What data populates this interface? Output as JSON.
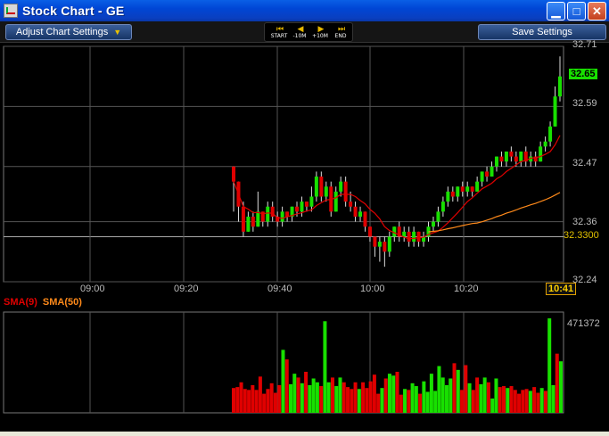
{
  "window": {
    "title": "Stock Chart - GE"
  },
  "toolbar": {
    "adjust_label": "Adjust Chart Settings",
    "save_label": "Save Settings",
    "playback": [
      {
        "icon": "skip-back-icon",
        "glyph": "⏮",
        "label": "START"
      },
      {
        "icon": "step-back-icon",
        "glyph": "◀",
        "label": "-10M"
      },
      {
        "icon": "step-forward-icon",
        "glyph": "▶",
        "label": "+10M"
      },
      {
        "icon": "skip-forward-icon",
        "glyph": "⏭",
        "label": "END"
      }
    ]
  },
  "colors": {
    "up": "#18e000",
    "down": "#e00000",
    "sma9": "#e00000",
    "sma50": "#ff8a1a",
    "grid": "#555555",
    "ref": "#e0c000"
  },
  "chart_data": {
    "type": "candlestick",
    "ticker": "GE",
    "time_ticks": [
      "09:00",
      "09:20",
      "09:40",
      "10:00",
      "10:20"
    ],
    "current_time": "10:41",
    "price_ticks": [
      "32.71",
      "32.59",
      "32.47",
      "32.36",
      "32.24"
    ],
    "current_price": "32.65",
    "reference_price": "32.3300",
    "ylim": [
      32.24,
      32.71
    ],
    "legend": [
      {
        "name": "SMA(9)",
        "color": "#e00000"
      },
      {
        "name": "SMA(50)",
        "color": "#ff8a1a"
      }
    ],
    "volume_max_label": "471372",
    "candles": [
      [
        32.47,
        32.44,
        32.38,
        32.47
      ],
      [
        32.44,
        32.39,
        32.36,
        32.44
      ],
      [
        32.39,
        32.34,
        32.33,
        32.4
      ],
      [
        32.34,
        32.37,
        32.34,
        32.38
      ],
      [
        32.37,
        32.35,
        32.34,
        32.38
      ],
      [
        32.35,
        32.38,
        32.35,
        32.42
      ],
      [
        32.38,
        32.36,
        32.35,
        32.38
      ],
      [
        32.36,
        32.39,
        32.35,
        32.4
      ],
      [
        32.39,
        32.37,
        32.36,
        32.4
      ],
      [
        32.37,
        32.36,
        32.35,
        32.38
      ],
      [
        32.36,
        32.38,
        32.35,
        32.39
      ],
      [
        32.38,
        32.37,
        32.36,
        32.38
      ],
      [
        32.37,
        32.39,
        32.36,
        32.39
      ],
      [
        32.39,
        32.38,
        32.37,
        32.4
      ],
      [
        32.38,
        32.4,
        32.37,
        32.41
      ],
      [
        32.4,
        32.39,
        32.38,
        32.4
      ],
      [
        32.39,
        32.41,
        32.38,
        32.43
      ],
      [
        32.41,
        32.45,
        32.4,
        32.46
      ],
      [
        32.45,
        32.41,
        32.4,
        32.46
      ],
      [
        32.41,
        32.43,
        32.4,
        32.44
      ],
      [
        32.43,
        32.38,
        32.37,
        32.44
      ],
      [
        32.38,
        32.42,
        32.38,
        32.43
      ],
      [
        32.42,
        32.44,
        32.41,
        32.45
      ],
      [
        32.44,
        32.4,
        32.39,
        32.45
      ],
      [
        32.4,
        32.39,
        32.38,
        32.42
      ],
      [
        32.39,
        32.37,
        32.36,
        32.4
      ],
      [
        32.37,
        32.38,
        32.36,
        32.39
      ],
      [
        32.38,
        32.35,
        32.34,
        32.38
      ],
      [
        32.35,
        32.33,
        32.32,
        32.35
      ],
      [
        32.33,
        32.31,
        32.29,
        32.33
      ],
      [
        32.31,
        32.32,
        32.28,
        32.33
      ],
      [
        32.32,
        32.3,
        32.27,
        32.33
      ],
      [
        32.3,
        32.33,
        32.29,
        32.34
      ],
      [
        32.33,
        32.35,
        32.32,
        32.35
      ],
      [
        32.35,
        32.33,
        32.32,
        32.36
      ],
      [
        32.33,
        32.34,
        32.32,
        32.35
      ],
      [
        32.34,
        32.32,
        32.31,
        32.35
      ],
      [
        32.32,
        32.34,
        32.31,
        32.35
      ],
      [
        32.34,
        32.32,
        32.31,
        32.34
      ],
      [
        32.32,
        32.33,
        32.31,
        32.34
      ],
      [
        32.33,
        32.35,
        32.32,
        32.36
      ],
      [
        32.35,
        32.36,
        32.34,
        32.37
      ],
      [
        32.36,
        32.38,
        32.35,
        32.39
      ],
      [
        32.38,
        32.4,
        32.37,
        32.41
      ],
      [
        32.4,
        32.42,
        32.39,
        32.43
      ],
      [
        32.42,
        32.41,
        32.4,
        32.43
      ],
      [
        32.41,
        32.43,
        32.4,
        32.43
      ],
      [
        32.43,
        32.42,
        32.41,
        32.44
      ],
      [
        32.42,
        32.43,
        32.41,
        32.44
      ],
      [
        32.43,
        32.42,
        32.41,
        32.43
      ],
      [
        32.42,
        32.44,
        32.42,
        32.45
      ],
      [
        32.44,
        32.46,
        32.43,
        32.46
      ],
      [
        32.46,
        32.45,
        32.44,
        32.47
      ],
      [
        32.45,
        32.47,
        32.45,
        32.48
      ],
      [
        32.47,
        32.49,
        32.46,
        32.49
      ],
      [
        32.49,
        32.48,
        32.47,
        32.5
      ],
      [
        32.48,
        32.5,
        32.47,
        32.5
      ],
      [
        32.5,
        32.49,
        32.48,
        32.51
      ],
      [
        32.49,
        32.48,
        32.47,
        32.5
      ],
      [
        32.48,
        32.5,
        32.47,
        32.5
      ],
      [
        32.5,
        32.48,
        32.47,
        32.51
      ],
      [
        32.48,
        32.49,
        32.47,
        32.5
      ],
      [
        32.49,
        32.48,
        32.47,
        32.5
      ],
      [
        32.48,
        32.51,
        32.48,
        32.52
      ],
      [
        32.51,
        32.52,
        32.5,
        32.53
      ],
      [
        32.52,
        32.55,
        32.51,
        32.56
      ],
      [
        32.55,
        32.61,
        32.55,
        32.63
      ],
      [
        32.61,
        32.65,
        32.6,
        32.69
      ]
    ],
    "volumes": [
      0.26,
      0.27,
      0.32,
      0.25,
      0.24,
      0.29,
      0.24,
      0.38,
      0.2,
      0.25,
      0.31,
      0.21,
      0.29,
      0.66,
      0.56,
      0.3,
      0.41,
      0.37,
      0.31,
      0.43,
      0.29,
      0.36,
      0.32,
      0.28,
      0.96,
      0.32,
      0.37,
      0.28,
      0.37,
      0.32,
      0.27,
      0.25,
      0.32,
      0.25,
      0.32,
      0.26,
      0.33,
      0.4,
      0.2,
      0.26,
      0.36,
      0.41,
      0.39,
      0.43,
      0.19,
      0.25,
      0.24,
      0.31,
      0.28,
      0.2,
      0.33,
      0.22,
      0.41,
      0.23,
      0.49,
      0.37,
      0.29,
      0.36,
      0.52,
      0.45,
      0.24,
      0.5,
      0.31,
      0.24,
      0.37,
      0.3,
      0.37,
      0.32,
      0.15,
      0.36,
      0.27,
      0.28,
      0.26,
      0.28,
      0.24,
      0.2,
      0.24,
      0.25,
      0.23,
      0.27,
      0.21,
      0.26,
      0.23,
      0.99,
      0.29,
      0.62,
      0.54
    ],
    "volume_colors": "mixed red/green by candle direction"
  }
}
